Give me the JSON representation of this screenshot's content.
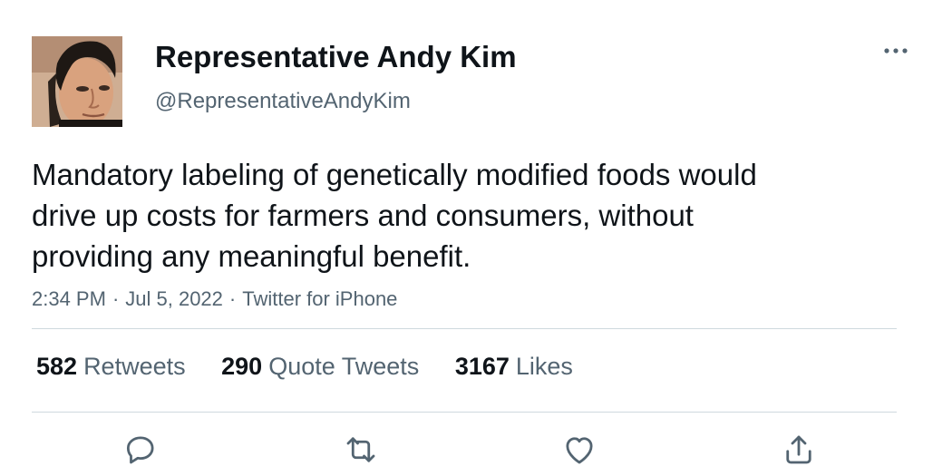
{
  "author": {
    "display_name": "Representative Andy Kim",
    "handle": "@RepresentativeAndyKim",
    "avatar_icon": "profile-photo"
  },
  "tweet": {
    "text": "Mandatory labeling of genetically modified foods would\ndrive up costs for farmers and consumers, without\nproviding any meaningful benefit.",
    "time": "2:34 PM",
    "separator": "·",
    "date": "Jul 5, 2022",
    "source": "Twitter for iPhone"
  },
  "stats": {
    "retweets": {
      "count": "582",
      "label": "Retweets"
    },
    "quote_tweets": {
      "count": "290",
      "label": "Quote Tweets"
    },
    "likes": {
      "count": "3167",
      "label": "Likes"
    }
  },
  "actions": [
    "reply-icon",
    "retweet-icon",
    "like-icon",
    "share-icon"
  ],
  "colors": {
    "text": "#0f1419",
    "secondary": "#536471",
    "divider": "#cfd9de",
    "background": "#ffffff"
  }
}
